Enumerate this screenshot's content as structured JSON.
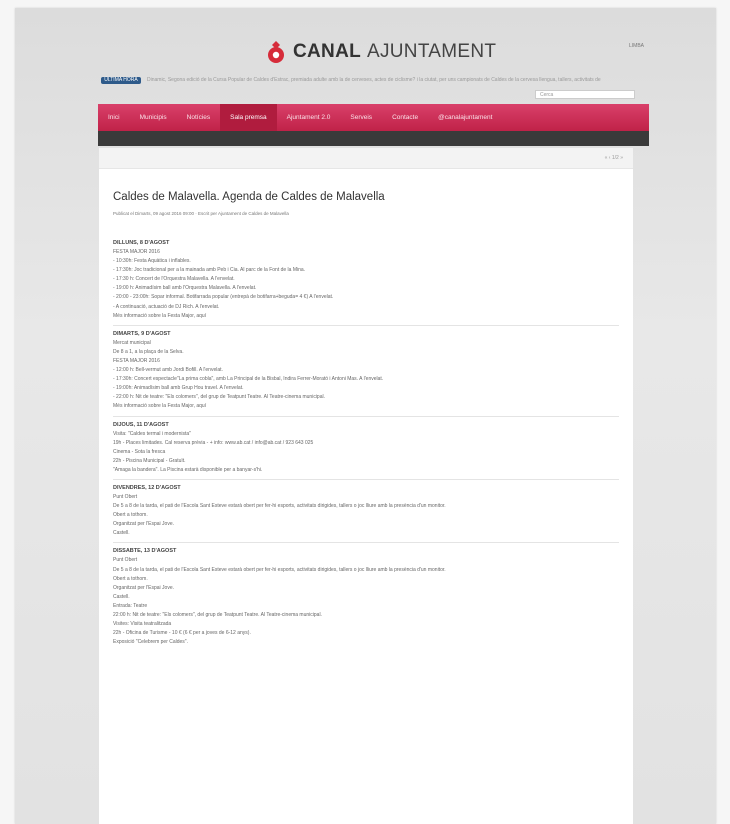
{
  "header": {
    "brand_bold": "CANAL",
    "brand_light": "AJUNTAMENT",
    "lang": "LIMBA",
    "ticker_badge": "ÚLTIMA HORA",
    "ticker_text": "Dinamic, Segona edició de la Cursa Popular de Caldes d'Estrac, premiada adulte amb la de cerveses, actes de ciclisme? i la ciutat, per uns campionats de Caldes de la cervesa llengua, tallers, activitats de",
    "search_placeholder": "Cerca"
  },
  "nav": {
    "items": [
      {
        "label": "Inici"
      },
      {
        "label": "Municipis"
      },
      {
        "label": "Notícies"
      },
      {
        "label": "Sala premsa"
      },
      {
        "label": "Ajuntament 2.0"
      },
      {
        "label": "Serveis"
      },
      {
        "label": "Contacte"
      },
      {
        "label": "@canalajuntament"
      }
    ],
    "active_index": 3
  },
  "article": {
    "pager": "« ‹ 1/2 »",
    "title": "Caldes de Malavella. Agenda de Caldes de Malavella",
    "meta": "Publicat el Dimarts, 09 agost 2016 09:00 · Escrit per Ajuntament de Caldes de Malavella",
    "sections": [
      {
        "head": "DILLUNS, 8 D'AGOST",
        "lines": [
          "FESTA MAJOR 2016",
          "- 10:30h: Festa Aquàtica i inflables.",
          "- 17:30h: Joc tradicional per a la mainada amb Peb i Cia. Al parc de la Font de la Mina.",
          "- 17:30 h: Concert de l'Orquestra Malavella. A l'envelat.",
          "- 19:00 h: Animadísim ball amb l'Orquestra Malavella. A l'envelat.",
          "- 20:00 - 23:00h: Sopar informal. Botifarrada popular (entrepà de botifarra+beguda= 4 €) A l'envelat.",
          "- A continuació, actuació de DJ Rich. A l'envelat.",
          "Més informació sobre la Festa Major, aquí"
        ]
      },
      {
        "head": "DIMARTS, 9 D'AGOST",
        "lines": [
          "Mercat municipal",
          "De 8 a 1, a la plaça de la Selva.",
          "FESTA MAJOR 2016",
          "- 12:00 h: Bell-vermut amb Jordi Bofill. A l'envelat.",
          "- 17:30h: Concert espectacle\"La prima cobla\", amb La Principal de la Bisbal, Indira Ferrer-Morató i Antoni Mas. A l'envelat.",
          "- 19:00h: Animadísim ball amb Grup Hou travel. A l'envelat.",
          "- 22:00 h: Nit de teatre: \"Els colomers\", del grup de Teatpunt Teatre. Al Teatre-cinema municipal.",
          "Més informació sobre la Festa Major, aquí"
        ]
      },
      {
        "head": "DIJOUS, 11 D'AGOST",
        "lines": [
          "Visita: \"Caldes termal i modernista\"",
          "19h - Places limitades. Cal reserva prèvia - + info: www.ab.cat / info@ab.cat / 923 643 025",
          "Cinema - Sota la fresca",
          "22h - Piscina Municipal - Gratuït.",
          "\"Amaga la bandera\". La Piscina estarà disponible per a banyar-s'hi."
        ]
      },
      {
        "head": "DIVENDRES, 12 D'AGOST",
        "lines": [
          "Punt Obert",
          "De 5 a 8 de la tarda, el pati de l'Escola Sant Esteve estarà obert per fer-hi esports, activitats dirigides, tallers o joc lliure amb la presència d'un monitor.",
          "Obert a tothom.",
          "Organitzat per l'Espai Jove.",
          "Castell."
        ]
      },
      {
        "head": "DISSABTE, 13 D'AGOST",
        "lines": [
          "Punt Obert",
          "De 5 a 8 de la tarda, el pati de l'Escola Sant Esteve estarà obert per fer-hi esports, activitats dirigides, tallers o joc lliure amb la presència d'un monitor.",
          "Obert a tothom.",
          "Organitzat per l'Espai Jove.",
          "Castell.",
          "Entrada: Teatre",
          "22:00 h: Nit de teatre: \"Els colomers\", del grup de Teatpunt Teatre. Al Teatre-cinema municipal.",
          "Visites: Visita teatralitzada",
          "22h - Oficina de Turisme - 10 € (6 € per a joves de 6-12 anys).",
          "Exposició \"Celebrem per Caldes\"."
        ]
      }
    ]
  },
  "colors": {
    "nav_pink": "#c02248",
    "logo_red": "#d62c3a",
    "subbar_dark": "#3a3a3a"
  }
}
